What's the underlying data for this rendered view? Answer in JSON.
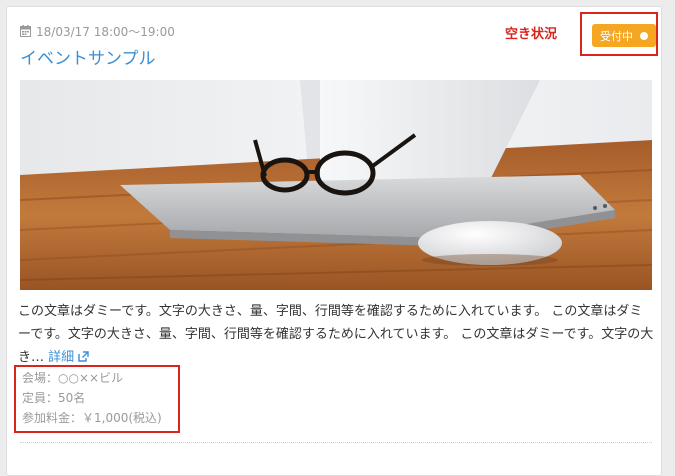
{
  "event": {
    "date_time": "18/03/17 18:00～19:00",
    "title": "イベントサンプル",
    "availability_label": "空き状況",
    "status_badge": "受付中",
    "description": "この文章はダミーです。文字の大きさ、量、字間、行間等を確認するために入れています。 この文章はダミーです。文字の大きさ、量、字間、行間等を確認するために入れています。 この文章はダミーです。文字の大き…",
    "detail_link": "詳細",
    "venue": "会場：○○××ビル",
    "capacity": "定員：50名",
    "fee": "参加料金：￥1,000(税込)"
  },
  "colors": {
    "link_blue": "#3b8fd6",
    "highlight_red": "#d9251c",
    "badge_orange": "#f5a623"
  },
  "icons": {
    "date": "calendar-icon",
    "external": "external-link-icon",
    "status": "dot-icon"
  }
}
